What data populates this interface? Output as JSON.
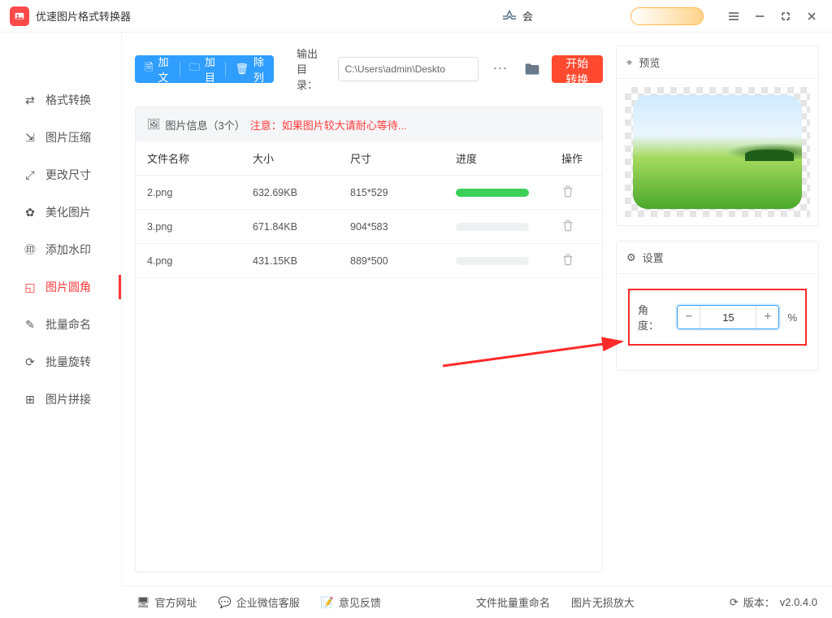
{
  "titlebar": {
    "title": "优速图片格式转换器",
    "center_label": "会"
  },
  "sidebar": {
    "items": [
      {
        "label": "格式转换"
      },
      {
        "label": "图片压缩"
      },
      {
        "label": "更改尺寸"
      },
      {
        "label": "美化图片"
      },
      {
        "label": "添加水印"
      },
      {
        "label": "图片圆角"
      },
      {
        "label": "批量命名"
      },
      {
        "label": "批量旋转"
      },
      {
        "label": "图片拼接"
      }
    ],
    "active_index": 5
  },
  "toolbar": {
    "add_file": "添加文件",
    "add_dir": "添加目录",
    "clear": "清除列表",
    "output_label": "输出目录：",
    "output_path": "C:\\Users\\admin\\Deskto",
    "convert": "开始转换"
  },
  "panel": {
    "info_prefix": "图片信息（3个）",
    "info_warn": "注意：如果图片较大请耐心等待...",
    "headers": {
      "name": "文件名称",
      "size": "大小",
      "dim": "尺寸",
      "prog": "进度",
      "op": "操作"
    },
    "rows": [
      {
        "name": "2.png",
        "size": "632.69KB",
        "dim": "815*529",
        "done": true
      },
      {
        "name": "3.png",
        "size": "671.84KB",
        "dim": "904*583",
        "done": false
      },
      {
        "name": "4.png",
        "size": "431.15KB",
        "dim": "889*500",
        "done": false
      }
    ]
  },
  "preview": {
    "title": "预览"
  },
  "settings": {
    "title": "设置",
    "angle_label": "角度：",
    "angle_value": "15",
    "pct": "%"
  },
  "footer": {
    "site": "官方网址",
    "wechat": "企业微信客服",
    "feedback": "意见反馈",
    "rename": "文件批量重命名",
    "enlarge": "图片无损放大",
    "version_label": "版本：",
    "version": "v2.0.4.0"
  }
}
